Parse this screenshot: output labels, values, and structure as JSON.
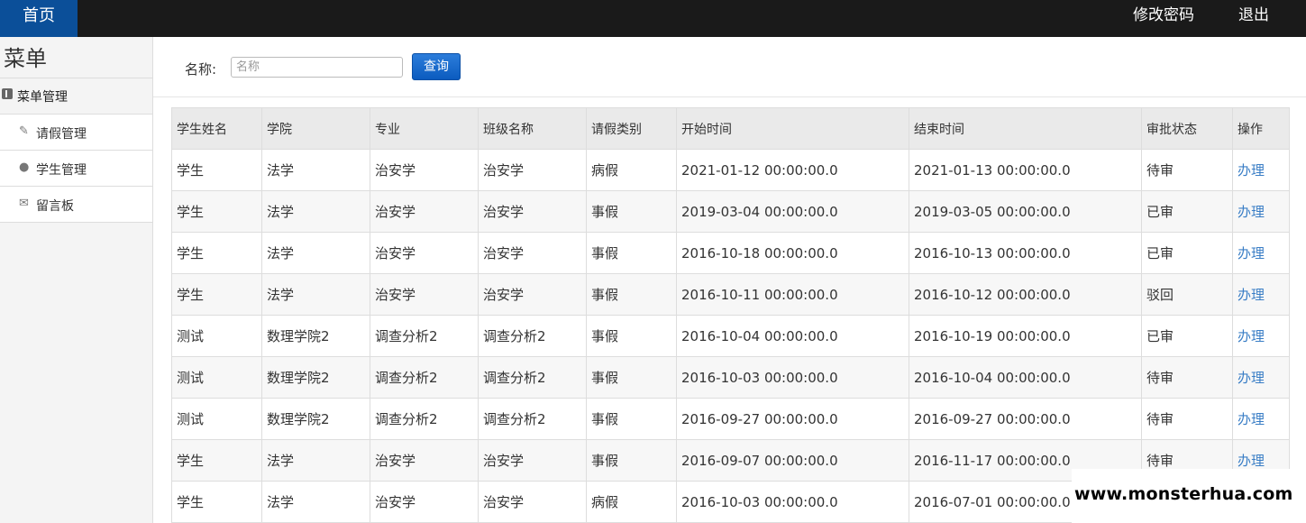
{
  "topbar": {
    "home": "首页",
    "change_password": "修改密码",
    "logout": "退出"
  },
  "sidebar": {
    "title": "菜单",
    "group": {
      "label": "菜单管理",
      "icon": "folder-icon"
    },
    "items": [
      {
        "label": "请假管理",
        "icon": "wrench-icon"
      },
      {
        "label": "学生管理",
        "icon": "comment-icon"
      },
      {
        "label": "留言板",
        "icon": "envelope-icon"
      }
    ]
  },
  "search": {
    "label": "名称:",
    "placeholder": "名称",
    "value": "",
    "button": "查询"
  },
  "table": {
    "columns": [
      "学生姓名",
      "学院",
      "专业",
      "班级名称",
      "请假类别",
      "开始时间",
      "结束时间",
      "审批状态",
      "操作"
    ],
    "rows": [
      [
        "学生",
        "法学",
        "治安学",
        "治安学",
        "病假",
        "2021-01-12 00:00:00.0",
        "2021-01-13 00:00:00.0",
        "待审",
        "办理"
      ],
      [
        "学生",
        "法学",
        "治安学",
        "治安学",
        "事假",
        "2019-03-04 00:00:00.0",
        "2019-03-05 00:00:00.0",
        "已审",
        "办理"
      ],
      [
        "学生",
        "法学",
        "治安学",
        "治安学",
        "事假",
        "2016-10-18 00:00:00.0",
        "2016-10-13 00:00:00.0",
        "已审",
        "办理"
      ],
      [
        "学生",
        "法学",
        "治安学",
        "治安学",
        "事假",
        "2016-10-11 00:00:00.0",
        "2016-10-12 00:00:00.0",
        "驳回",
        "办理"
      ],
      [
        "测试",
        "数理学院2",
        "调查分析2",
        "调查分析2",
        "事假",
        "2016-10-04 00:00:00.0",
        "2016-10-19 00:00:00.0",
        "已审",
        "办理"
      ],
      [
        "测试",
        "数理学院2",
        "调查分析2",
        "调查分析2",
        "事假",
        "2016-10-03 00:00:00.0",
        "2016-10-04 00:00:00.0",
        "待审",
        "办理"
      ],
      [
        "测试",
        "数理学院2",
        "调查分析2",
        "调查分析2",
        "事假",
        "2016-09-27 00:00:00.0",
        "2016-09-27 00:00:00.0",
        "待审",
        "办理"
      ],
      [
        "学生",
        "法学",
        "治安学",
        "治安学",
        "事假",
        "2016-09-07 00:00:00.0",
        "2016-11-17 00:00:00.0",
        "待审",
        "办理"
      ],
      [
        "学生",
        "法学",
        "治安学",
        "治安学",
        "病假",
        "2016-10-03 00:00:00.0",
        "2016-07-01 00:00:00.0",
        "",
        ""
      ]
    ]
  },
  "watermark": "www.monsterhua.com",
  "colors": {
    "topbar": "#1a1a1a",
    "home_tab": "#0b4f99",
    "button": "#0b5bbf",
    "link": "#3a7ec6"
  }
}
